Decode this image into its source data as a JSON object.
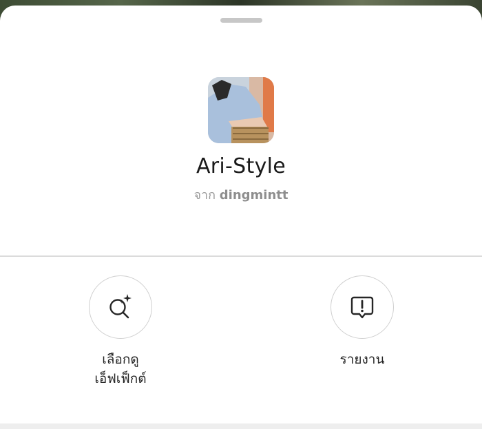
{
  "effect_sheet": {
    "title": "Ari-Style",
    "byline_prefix": "จาก",
    "creator": "dingmintt"
  },
  "actions": [
    {
      "label_line1": "เลือกดู",
      "label_line2": "เอ็ฟเฟ็กต์",
      "icon": "sparkle-search-icon"
    },
    {
      "label_line1": "รายงาน",
      "label_line2": "",
      "icon": "report-flag-icon"
    }
  ]
}
